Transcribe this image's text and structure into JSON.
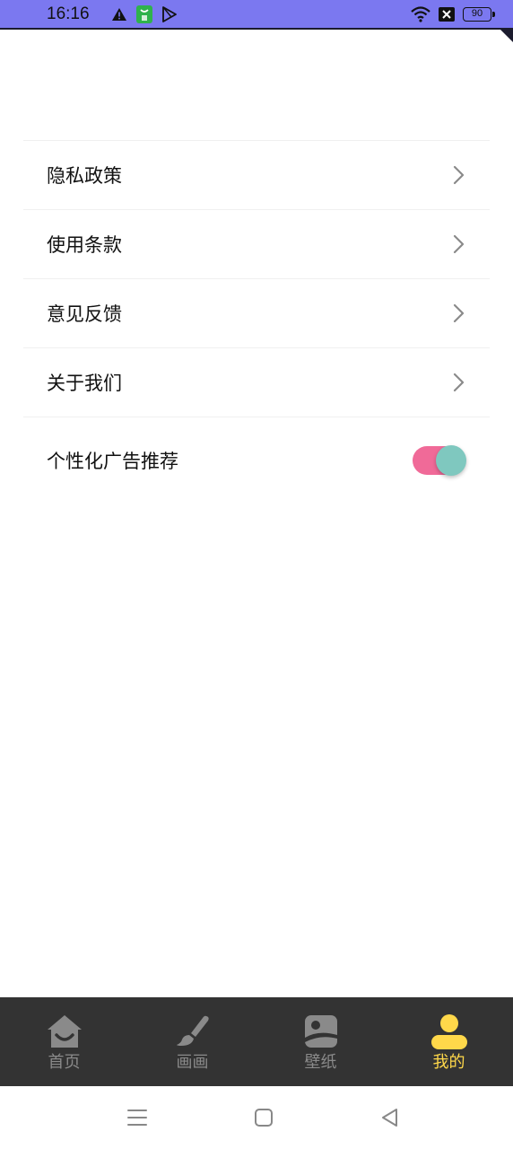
{
  "status_bar": {
    "time": "16:16",
    "battery_level": "90",
    "bar_color": "#7b78f0",
    "left_icons": [
      "warning-icon",
      "app-notification-icon",
      "play-store-icon"
    ],
    "right_icons": [
      "wifi-icon",
      "sim-x-icon",
      "battery-icon"
    ]
  },
  "settings": {
    "items": [
      {
        "label": "隐私政策",
        "type": "link"
      },
      {
        "label": "使用条款",
        "type": "link"
      },
      {
        "label": "意见反馈",
        "type": "link"
      },
      {
        "label": "关于我们",
        "type": "link"
      }
    ],
    "ad_toggle": {
      "label": "个性化广告推荐",
      "on": true,
      "track_color": "#f06a98",
      "knob_color": "#7fc8bf"
    }
  },
  "tab_bar": {
    "background": "#333333",
    "tabs": [
      {
        "label": "首页",
        "icon": "home-icon",
        "active": false
      },
      {
        "label": "画画",
        "icon": "brush-icon",
        "active": false
      },
      {
        "label": "壁纸",
        "icon": "wallpaper-icon",
        "active": false
      },
      {
        "label": "我的",
        "icon": "person-icon",
        "active": true
      }
    ],
    "active_color": "#ffd84a",
    "inactive_color": "#8a8a8a"
  },
  "system_nav": {
    "buttons": [
      "menu-icon",
      "home-square-icon",
      "back-triangle-icon"
    ]
  }
}
